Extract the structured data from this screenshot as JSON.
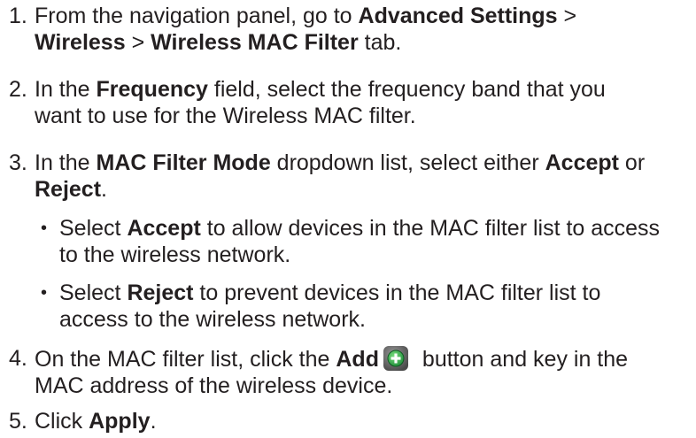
{
  "steps": [
    {
      "num": "1.",
      "line1_pre": "From the navigation panel, go to ",
      "line1_b1": "Advanced Settings",
      "line1_post": " >",
      "line2_b1": "Wireless",
      "line2_mid": " > ",
      "line2_b2": "Wireless MAC Filter",
      "line2_post": " tab."
    },
    {
      "num": "2.",
      "line1_pre": "In the ",
      "line1_b1": "Frequency",
      "line1_post": " field, select the frequency band that you",
      "line2": "want to use for the Wireless MAC filter."
    },
    {
      "num": "3.",
      "line1_pre": "In the ",
      "line1_b1": "MAC Filter Mode",
      "line1_mid": " dropdown list, select either ",
      "line1_b2": "Accept",
      "line1_post": " or",
      "line2_b1": "Reject",
      "line2_post": "."
    },
    {
      "num": "4.",
      "line1_pre": "On the MAC filter list, click the ",
      "line1_b1": "Add",
      "line1_post": " button and key in the",
      "line2": "MAC address of the wireless device.",
      "icon": "add-circle-icon"
    },
    {
      "num": "5.",
      "line1_pre": "Click ",
      "line1_b1": "Apply",
      "line1_post": "."
    }
  ],
  "bullets": [
    {
      "dot": "•",
      "line1_pre": "Select ",
      "line1_b1": "Accept",
      "line1_post": " to allow devices in the MAC filter list to access",
      "line2": "to the wireless network."
    },
    {
      "dot": "•",
      "line1_pre": "Select ",
      "line1_b1": "Reject",
      "line1_post": " to prevent devices in the MAC filter list to",
      "line2": "access to the wireless network."
    }
  ],
  "colors": {
    "text": "#231f20",
    "icon_bg": "#6f6f6f",
    "icon_accent": "#2fa84f"
  }
}
